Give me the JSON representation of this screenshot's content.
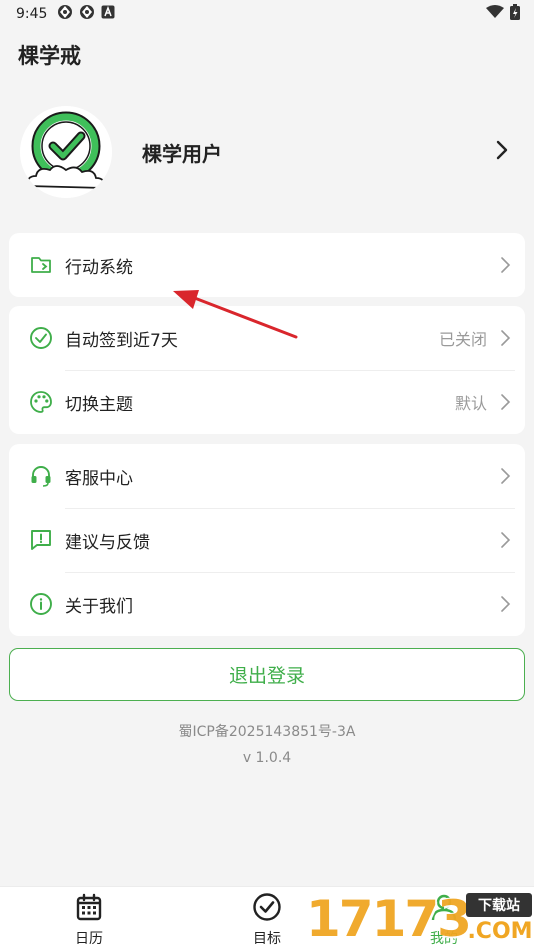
{
  "status_bar": {
    "time": "9:45",
    "icons": [
      "vpn-icon",
      "vpn-icon",
      "notification-a-icon"
    ],
    "right_icons": [
      "wifi-icon",
      "battery-icon"
    ]
  },
  "app": {
    "title": "棵学戒"
  },
  "profile": {
    "name": "棵学用户",
    "avatar_icon": "checkmark-cloud-logo-icon"
  },
  "menu_groups": [
    [
      {
        "icon": "folder-icon",
        "label": "行动系统",
        "value": ""
      }
    ],
    [
      {
        "icon": "check-circle-icon",
        "label": "自动签到近7天",
        "value": "已关闭"
      },
      {
        "icon": "palette-icon",
        "label": "切换主题",
        "value": "默认"
      }
    ],
    [
      {
        "icon": "headset-icon",
        "label": "客服中心",
        "value": ""
      },
      {
        "icon": "feedback-icon",
        "label": "建议与反馈",
        "value": ""
      },
      {
        "icon": "info-icon",
        "label": "关于我们",
        "value": ""
      }
    ]
  ],
  "logout": {
    "label": "退出登录"
  },
  "footer": {
    "icp": "蜀ICP备2025143851号-3A",
    "version": "v 1.0.4"
  },
  "tabs": [
    {
      "icon": "calendar-icon",
      "label": "日历"
    },
    {
      "icon": "target-check-icon",
      "label": "目标"
    },
    {
      "icon": "user-icon",
      "label": "我的"
    }
  ],
  "watermark": {
    "digits": "17173",
    "badge": "下载站",
    "domain": ".COM"
  },
  "colors": {
    "accent": "#3fae4a",
    "background": "#f4f4f4",
    "annotation_arrow": "#d9262c"
  }
}
